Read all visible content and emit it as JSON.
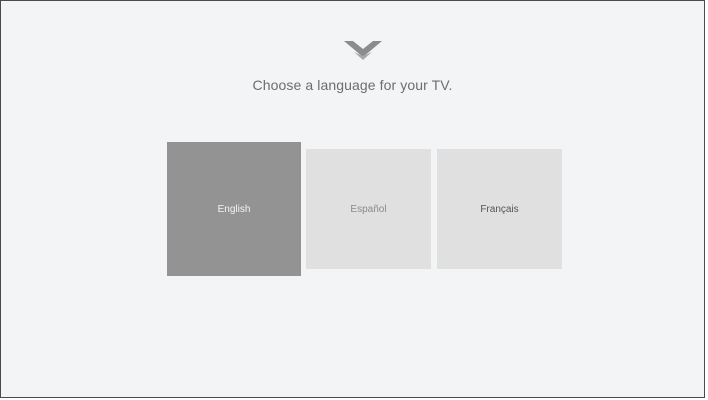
{
  "header": {
    "logo_icon": "vizio-v-icon",
    "title": "Choose a language for your TV."
  },
  "languages": [
    {
      "label": "English",
      "selected": true
    },
    {
      "label": "Español",
      "selected": false
    },
    {
      "label": "Français",
      "selected": false
    }
  ],
  "colors": {
    "background": "#f3f4f6",
    "selected_tile": "#939393",
    "unselected_tile": "#e0e0e0",
    "logo": "#8c8c8c"
  }
}
